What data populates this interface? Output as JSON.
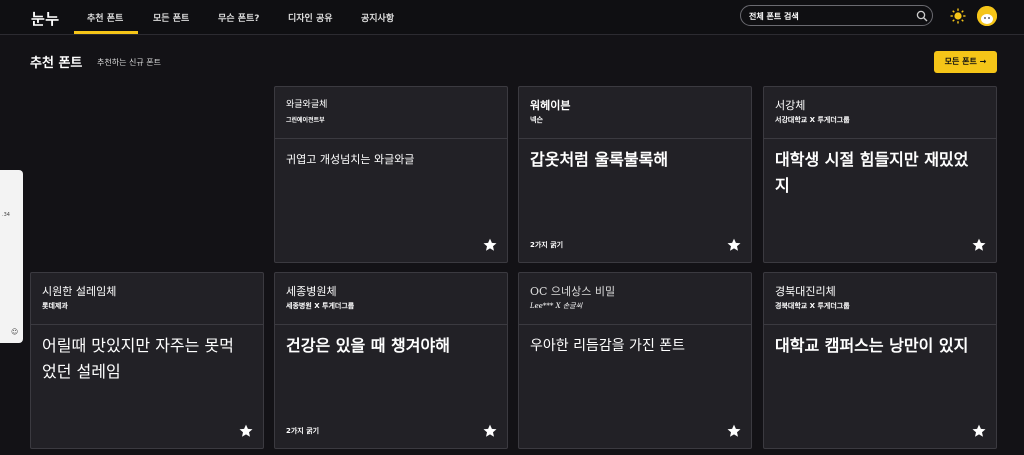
{
  "header": {
    "logo": "눈누",
    "nav": [
      "추천 폰트",
      "모든 폰트",
      "무슨 폰트?",
      "디자인 공유",
      "공지사항"
    ],
    "search_placeholder": "전체 폰트 검색",
    "icons": {
      "search": "search-icon",
      "theme": "sun-icon",
      "avatar": "avatar"
    }
  },
  "section": {
    "title": "추천 폰트",
    "subtitle": "추천하는 신규 폰트",
    "all_button": "모든 폰트 →"
  },
  "side_widget": {
    "number": ".34"
  },
  "cards": [
    {
      "name": "와글와글체",
      "maker": "그린에이전트부",
      "sample": "귀엽고 개성넘치는 와글와글",
      "weights": ""
    },
    {
      "name": "워헤이븐",
      "maker": "넥슨",
      "sample": "갑옷처럼 울록불록해",
      "weights": "2가지 굵기"
    },
    {
      "name": "서강체",
      "maker": "서강대학교 X 투게더그룹",
      "sample": "대학생 시절 힘들지만 재밌었지",
      "weights": ""
    },
    {
      "name": "시원한 설레임체",
      "maker": "롯데제과",
      "sample": "어릴때 맛있지만 자주는 못먹었던 설레임",
      "weights": ""
    },
    {
      "name": "세종병원체",
      "maker": "세종병원 X 투게더그룹",
      "sample": "건강은 있을 때 챙겨야해",
      "weights": "2가지 굵기"
    },
    {
      "name": "OC 으네상스 비밀",
      "maker": "Lee*** X 손글씨",
      "sample": "우아한 리듬감을 가진 폰트",
      "weights": ""
    },
    {
      "name": "경북대진리체",
      "maker": "경북대학교 X 투게더그룹",
      "sample": "대학교 캠퍼스는 낭만이 있지",
      "weights": ""
    }
  ],
  "colors": {
    "accent": "#f5c518",
    "background": "#131216",
    "card": "#222126",
    "border": "#3b3a40"
  }
}
